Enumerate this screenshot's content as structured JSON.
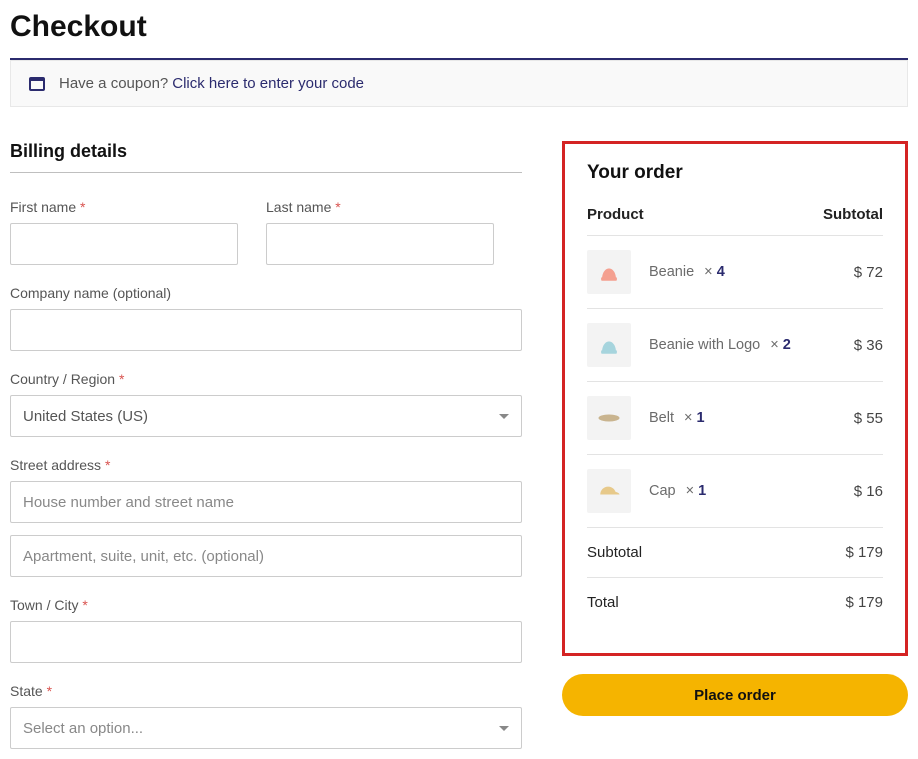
{
  "pageTitle": "Checkout",
  "coupon": {
    "question": "Have a coupon?",
    "link": "Click here to enter your code"
  },
  "billing": {
    "title": "Billing details",
    "fields": {
      "firstName": {
        "label": "First name",
        "value": ""
      },
      "lastName": {
        "label": "Last name",
        "value": ""
      },
      "company": {
        "label": "Company name (optional)",
        "value": ""
      },
      "countryLabel": "Country / Region",
      "countryValue": "United States (US)",
      "streetLabel": "Street address",
      "street1Placeholder": "House number and street name",
      "street2Placeholder": "Apartment, suite, unit, etc. (optional)",
      "townLabel": "Town / City",
      "stateLabel": "State",
      "statePlaceholder": "Select an option..."
    }
  },
  "order": {
    "title": "Your order",
    "headProduct": "Product",
    "headSubtotal": "Subtotal",
    "items": [
      {
        "name": "Beanie",
        "qty": "4",
        "price": "$ 72",
        "thumbColor": "#f4a090"
      },
      {
        "name": "Beanie with Logo",
        "qty": "2",
        "price": "$ 36",
        "thumbColor": "#a6d4dd"
      },
      {
        "name": "Belt",
        "qty": "1",
        "price": "$ 55",
        "thumbColor": "#c9b48f"
      },
      {
        "name": "Cap",
        "qty": "1",
        "price": "$ 16",
        "thumbColor": "#e7c98a"
      }
    ],
    "subtotalLabel": "Subtotal",
    "subtotalValue": "$ 179",
    "totalLabel": "Total",
    "totalValue": "$ 179",
    "placeOrder": "Place order"
  }
}
